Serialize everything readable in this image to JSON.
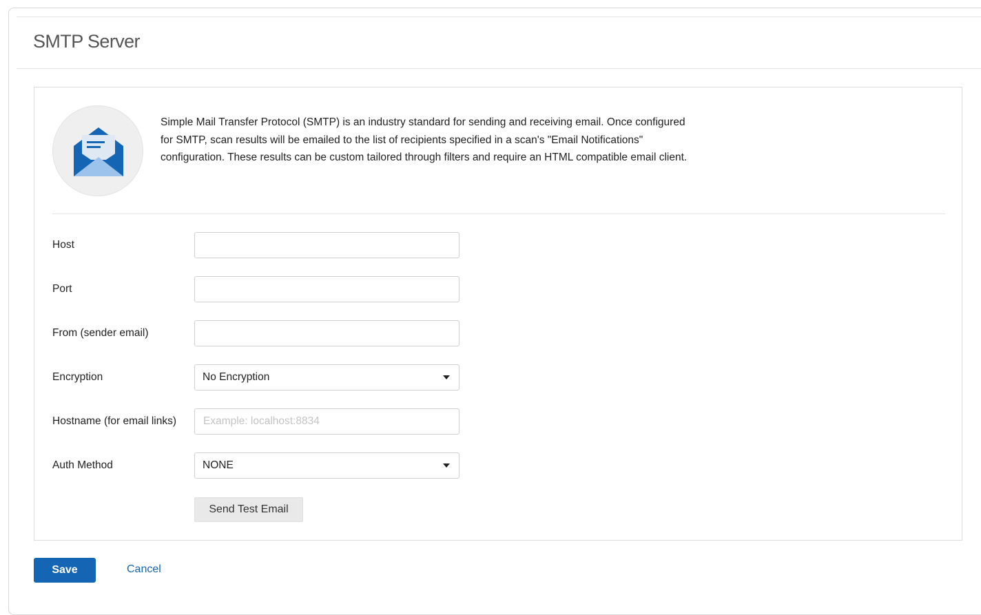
{
  "page": {
    "title": "SMTP Server"
  },
  "intro": {
    "icon": "envelope-open-icon",
    "description": "Simple Mail Transfer Protocol (SMTP) is an industry standard for sending and receiving email. Once configured for SMTP, scan results will be emailed to the list of recipients specified in a scan's \"Email Notifications\" configuration. These results can be custom tailored through filters and require an HTML compatible email client."
  },
  "form": {
    "host": {
      "label": "Host",
      "value": "",
      "placeholder": ""
    },
    "port": {
      "label": "Port",
      "value": "",
      "placeholder": ""
    },
    "from": {
      "label": "From (sender email)",
      "value": "",
      "placeholder": ""
    },
    "encryption": {
      "label": "Encryption",
      "selected": "No Encryption"
    },
    "hostname": {
      "label": "Hostname (for email links)",
      "value": "",
      "placeholder": "Example: localhost:8834"
    },
    "auth_method": {
      "label": "Auth Method",
      "selected": "NONE"
    },
    "send_test_label": "Send Test Email"
  },
  "actions": {
    "save_label": "Save",
    "cancel_label": "Cancel"
  },
  "colors": {
    "primary": "#1565b5",
    "icon_dark": "#1565b5",
    "icon_light": "#9cc3ec"
  }
}
